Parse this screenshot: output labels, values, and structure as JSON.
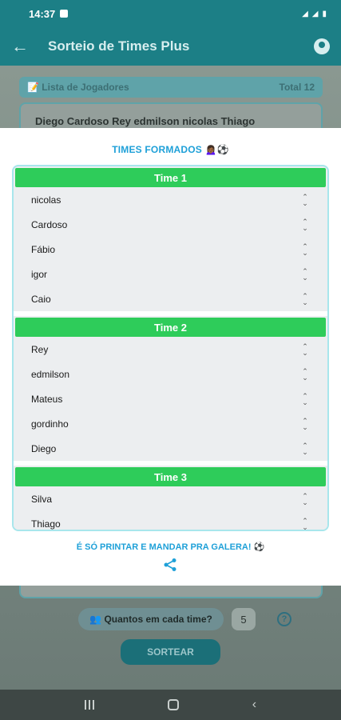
{
  "status_bar": {
    "time": "14:37"
  },
  "app_bar": {
    "title": "Sorteio de Times Plus"
  },
  "background": {
    "list_header": "📝 Lista de Jogadores",
    "list_total": "Total 12",
    "players_text": "Diego Cardoso Rey edmilson nicolas Thiago",
    "quantos_label": "👥 Quantos em cada time?",
    "quantity_value": "5",
    "help_label": "?",
    "sortear_button": "SORTEAR"
  },
  "modal": {
    "title": "TIMES FORMADOS 🙍🏾‍♀️⚽",
    "footer": "É SÓ PRINTAR E MANDAR PRA GALERA! ⚽",
    "teams": [
      {
        "name": "Time 1",
        "players": [
          "nicolas",
          "Cardoso",
          "Fábio",
          "igor",
          "Caio"
        ]
      },
      {
        "name": "Time 2",
        "players": [
          "Rey",
          "edmilson",
          "Mateus",
          "gordinho",
          "Diego"
        ]
      },
      {
        "name": "Time 3",
        "players": [
          "Silva",
          "Thiago"
        ]
      }
    ]
  },
  "icons": {
    "back": "arrow-left-icon",
    "account": "account-circle-icon",
    "sort": "unfold-more-icon",
    "share": "share-icon"
  },
  "colors": {
    "primary": "#1c7f86",
    "team_header": "#2ecc5a",
    "accent_text": "#1ea0d8"
  }
}
